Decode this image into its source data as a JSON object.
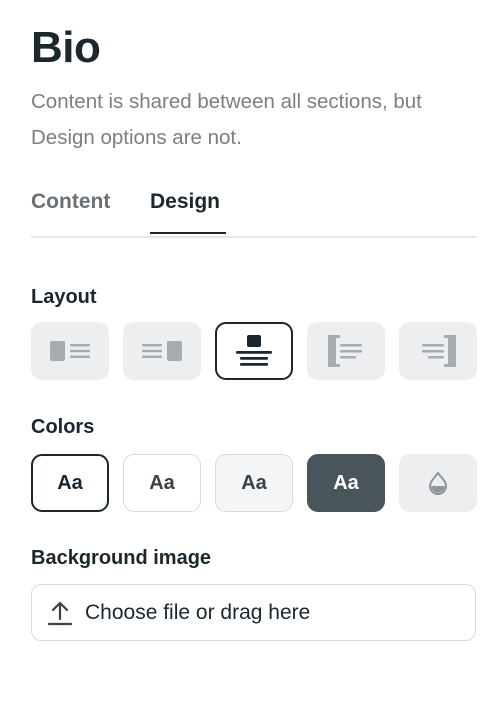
{
  "header": {
    "title": "Bio",
    "subtitle": "Content is shared between all sections, but Design options are not."
  },
  "tabs": [
    {
      "label": "Content",
      "active": false
    },
    {
      "label": "Design",
      "active": true
    }
  ],
  "layout": {
    "label": "Layout",
    "options": [
      {
        "icon": "layout-image-left-icon",
        "selected": false
      },
      {
        "icon": "layout-image-right-icon",
        "selected": false
      },
      {
        "icon": "layout-image-top-centered-icon",
        "selected": true
      },
      {
        "icon": "layout-bar-left-icon",
        "selected": false
      },
      {
        "icon": "layout-bar-right-icon",
        "selected": false
      }
    ]
  },
  "colors": {
    "label": "Colors",
    "options": [
      {
        "text": "Aa",
        "background": "#ffffff",
        "foreground": "#1c262d",
        "selected": true
      },
      {
        "text": "Aa",
        "background": "#ffffff",
        "foreground": "#3a4248",
        "selected": false
      },
      {
        "text": "Aa",
        "background": "#f3f5f7",
        "foreground": "#3a4248",
        "selected": false
      },
      {
        "text": "Aa",
        "background": "#4a545b",
        "foreground": "#ffffff",
        "selected": false
      },
      {
        "icon": "color-drop-icon",
        "selected": false
      }
    ]
  },
  "background_image": {
    "label": "Background image",
    "upload_label": "Choose file or drag here",
    "icon": "upload-icon"
  },
  "theme": {
    "text_primary": "#1c262d",
    "text_muted": "#7a7f84",
    "option_bg": "#eceef0",
    "border": "#d7dadd"
  }
}
